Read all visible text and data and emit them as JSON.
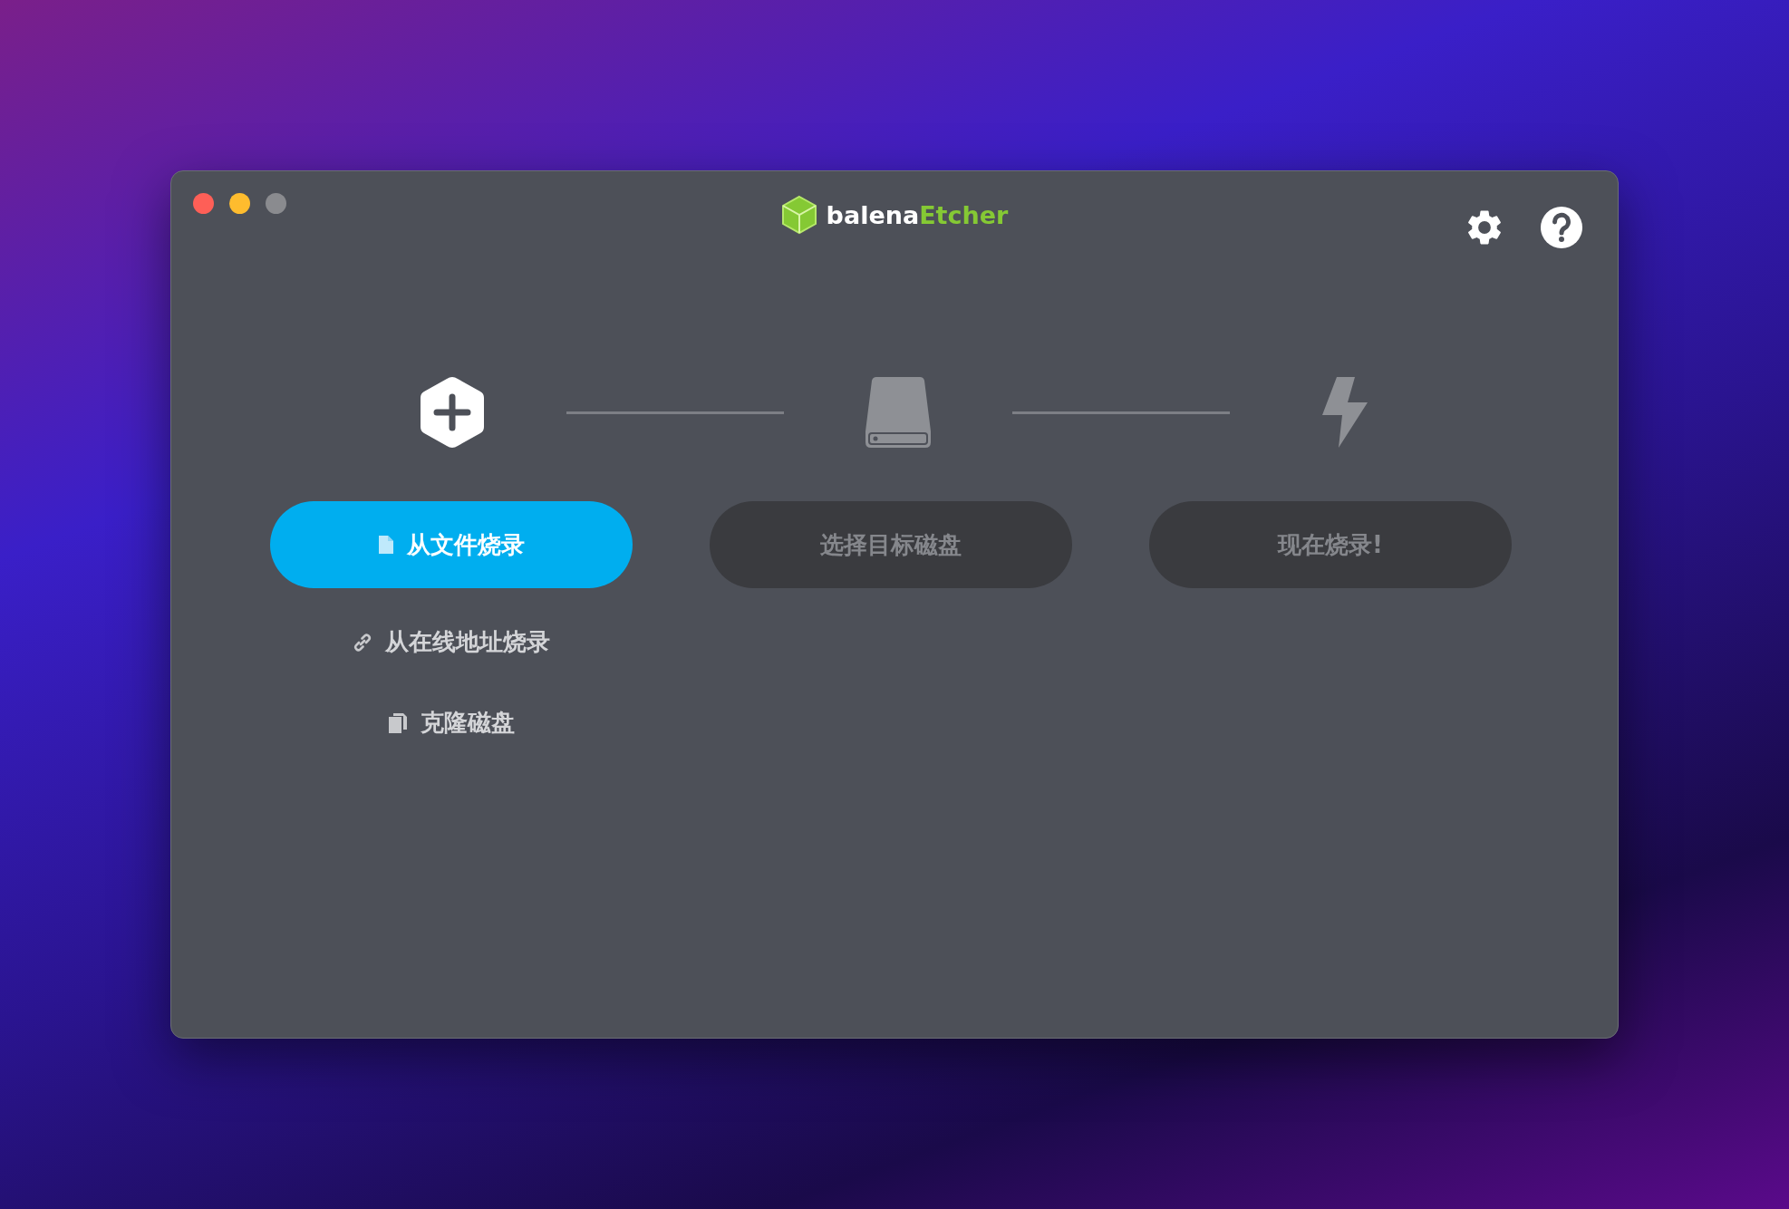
{
  "logo": {
    "prefix": "balena",
    "name": "Etcher"
  },
  "steps": [
    {
      "kind": "source",
      "button": "从文件烧录",
      "disabled": false
    },
    {
      "kind": "target",
      "button": "选择目标磁盘",
      "disabled": true
    },
    {
      "kind": "flash",
      "button": "现在烧录!",
      "disabled": true
    }
  ],
  "source_options": [
    {
      "kind": "url",
      "label": "从在线地址烧录"
    },
    {
      "kind": "clone",
      "label": "克隆磁盘"
    }
  ]
}
